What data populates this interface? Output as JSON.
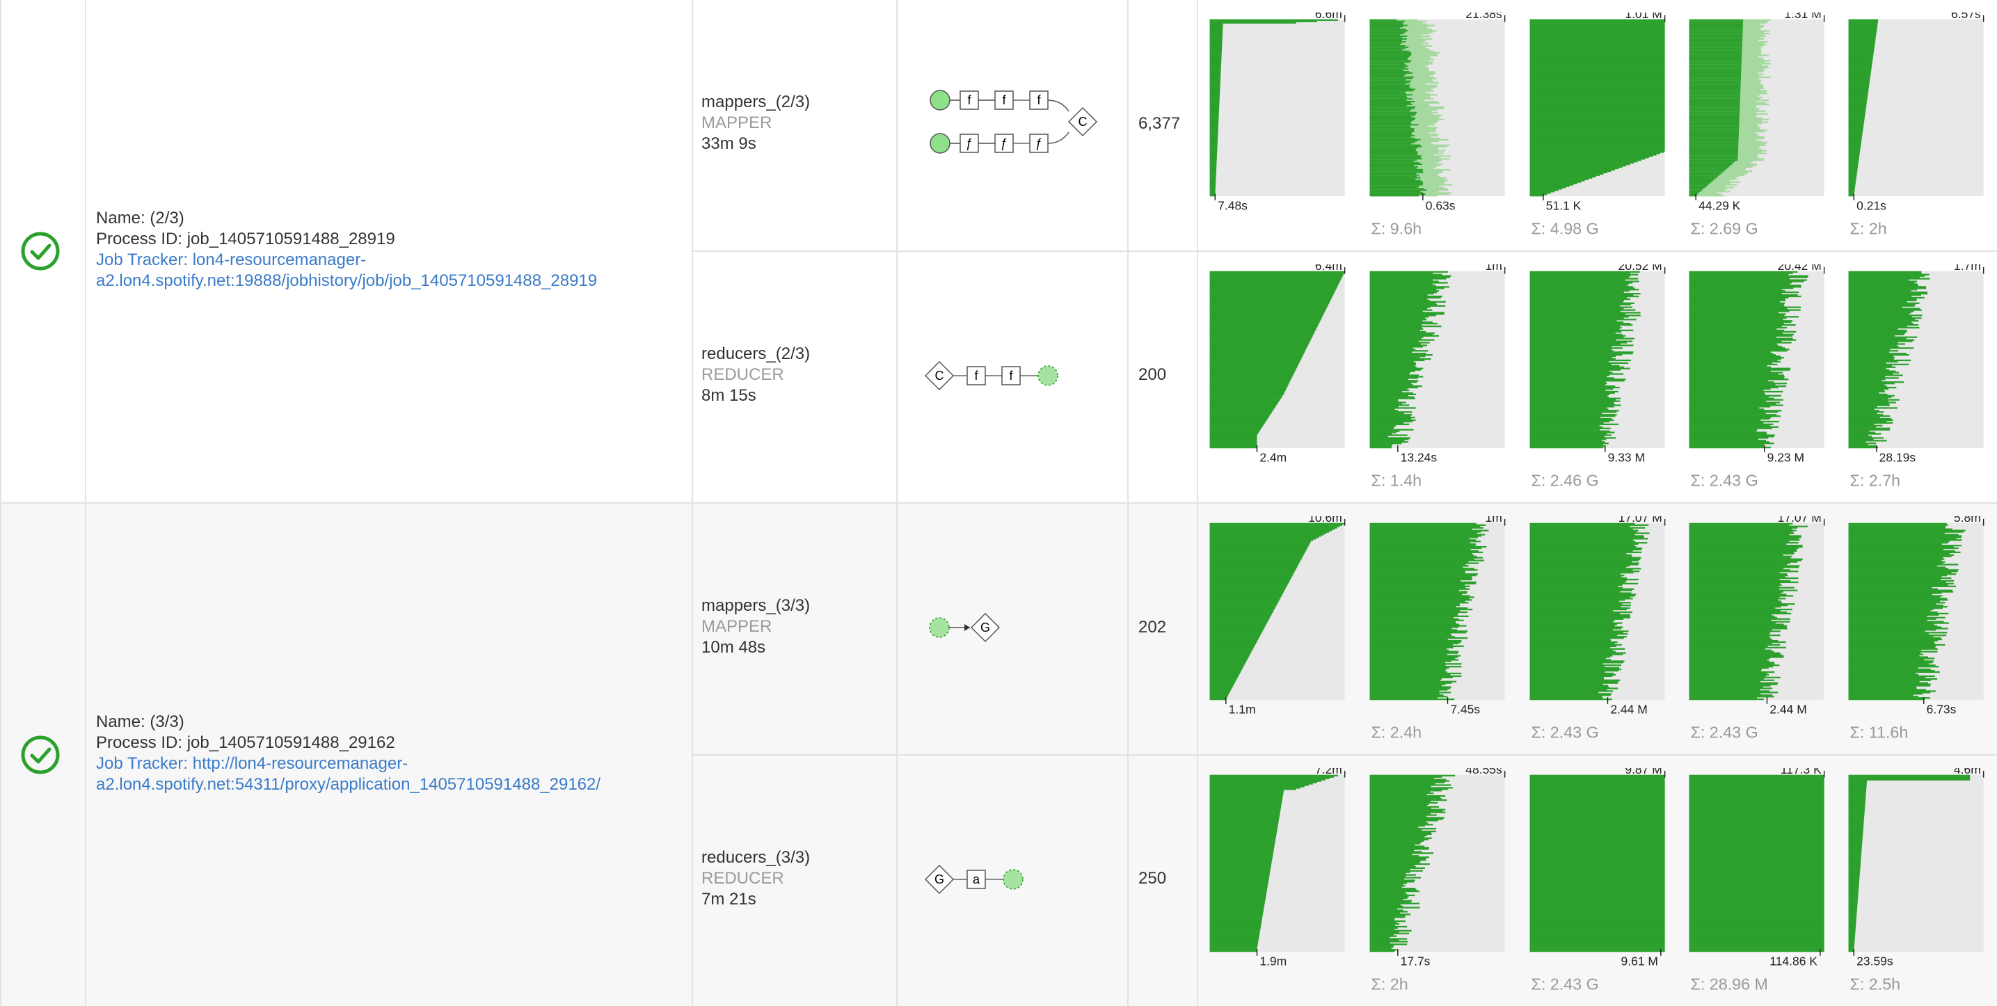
{
  "colors": {
    "green": "#2ca02c",
    "green_light": "#a6d9a0",
    "bg_chart": "#e8e8e8",
    "link": "#3a7bc8",
    "status": "#2ca02c"
  },
  "status_icon": "check-circle-icon",
  "jobs": [
    {
      "name": "Name: (2/3)",
      "process_id": "Process ID: job_1405710591488_28919",
      "tracker": "Job Tracker: lon4-resourcemanager-a2.lon4.spotify.net:19888/jobhistory/job/job_1405710591488_28919",
      "steps": [
        {
          "name": "mappers_(2/3)",
          "type": "MAPPER",
          "duration": "33m 9s",
          "count": "6,377",
          "charts": [
            {
              "max": "6.6m",
              "min": "7.48s",
              "sum": "",
              "shape": "mapper_dur"
            },
            {
              "max": "21.38s",
              "min": "0.63s",
              "sum": "Σ: 9.6h",
              "shape": "mapper_dist"
            },
            {
              "max": "1.01 M",
              "min": "51.1 K",
              "sum": "Σ: 4.98 G",
              "shape": "mapper_records"
            },
            {
              "max": "1.31 M",
              "min": "44.29 K",
              "sum": "Σ: 2.69 G",
              "shape": "mapper_records2"
            },
            {
              "max": "6.57s",
              "min": "0.21s",
              "sum": "Σ: 2h",
              "shape": "mapper_cpu"
            }
          ]
        },
        {
          "name": "reducers_(2/3)",
          "type": "REDUCER",
          "duration": "8m 15s",
          "count": "200",
          "charts": [
            {
              "max": "6.4m",
              "min": "2.4m",
              "sum": "",
              "shape": "diag"
            },
            {
              "max": "1m",
              "min": "13.24s",
              "sum": "Σ: 1.4h",
              "shape": "noisy_left"
            },
            {
              "max": "20.52 M",
              "min": "9.33 M",
              "sum": "Σ: 2.46 G",
              "shape": "noisy_mid"
            },
            {
              "max": "20.42 M",
              "min": "9.23 M",
              "sum": "Σ: 2.43 G",
              "shape": "noisy_mid"
            },
            {
              "max": "1.7m",
              "min": "28.19s",
              "sum": "Σ: 2.7h",
              "shape": "noisy_left"
            }
          ]
        }
      ]
    },
    {
      "name": "Name: (3/3)",
      "process_id": "Process ID: job_1405710591488_29162",
      "tracker": "Job Tracker: http://lon4-resourcemanager-a2.lon4.spotify.net:54311/proxy/application_1405710591488_29162/",
      "steps": [
        {
          "name": "mappers_(3/3)",
          "type": "MAPPER",
          "duration": "10m 48s",
          "count": "202",
          "charts": [
            {
              "max": "10.6m",
              "min": "1.1m",
              "sum": "",
              "shape": "scurve"
            },
            {
              "max": "1m",
              "min": "7.45s",
              "sum": "Σ: 2.4h",
              "shape": "noisy_right"
            },
            {
              "max": "17.07 M",
              "min": "2.44 M",
              "sum": "Σ: 2.43 G",
              "shape": "noisy_right"
            },
            {
              "max": "17.07 M",
              "min": "2.44 M",
              "sum": "Σ: 2.43 G",
              "shape": "noisy_right"
            },
            {
              "max": "5.8m",
              "min": "6.73s",
              "sum": "Σ: 11.6h",
              "shape": "noisy_mid"
            }
          ]
        },
        {
          "name": "reducers_(3/3)",
          "type": "REDUCER",
          "duration": "7m 21s",
          "count": "250",
          "charts": [
            {
              "max": "7.2m",
              "min": "1.9m",
              "sum": "",
              "shape": "steep"
            },
            {
              "max": "48.55s",
              "min": "17.7s",
              "sum": "Σ: 2h",
              "shape": "noisy_left"
            },
            {
              "max": "9.87 M",
              "min": "9.61 M",
              "sum": "Σ: 2.43 G",
              "shape": "full"
            },
            {
              "max": "117.3 K",
              "min": "114.86 K",
              "sum": "Σ: 28.96 M",
              "shape": "full"
            },
            {
              "max": "4.6m",
              "min": "23.59s",
              "sum": "Σ: 2.5h",
              "shape": "tiny"
            }
          ]
        }
      ]
    }
  ],
  "flows": [
    {
      "start": "filled",
      "nodes": [
        [
          "f",
          "f",
          "f"
        ],
        [
          "ƒ",
          "ƒ",
          "ƒ"
        ]
      ],
      "end": "C"
    },
    {
      "start": "C",
      "nodes": [
        "f",
        "f"
      ],
      "end": "dashed"
    },
    {
      "start": "dashed",
      "nodes": [],
      "end": "G"
    },
    {
      "start": "G",
      "nodes": [
        "a"
      ],
      "end": "dashed"
    }
  ]
}
